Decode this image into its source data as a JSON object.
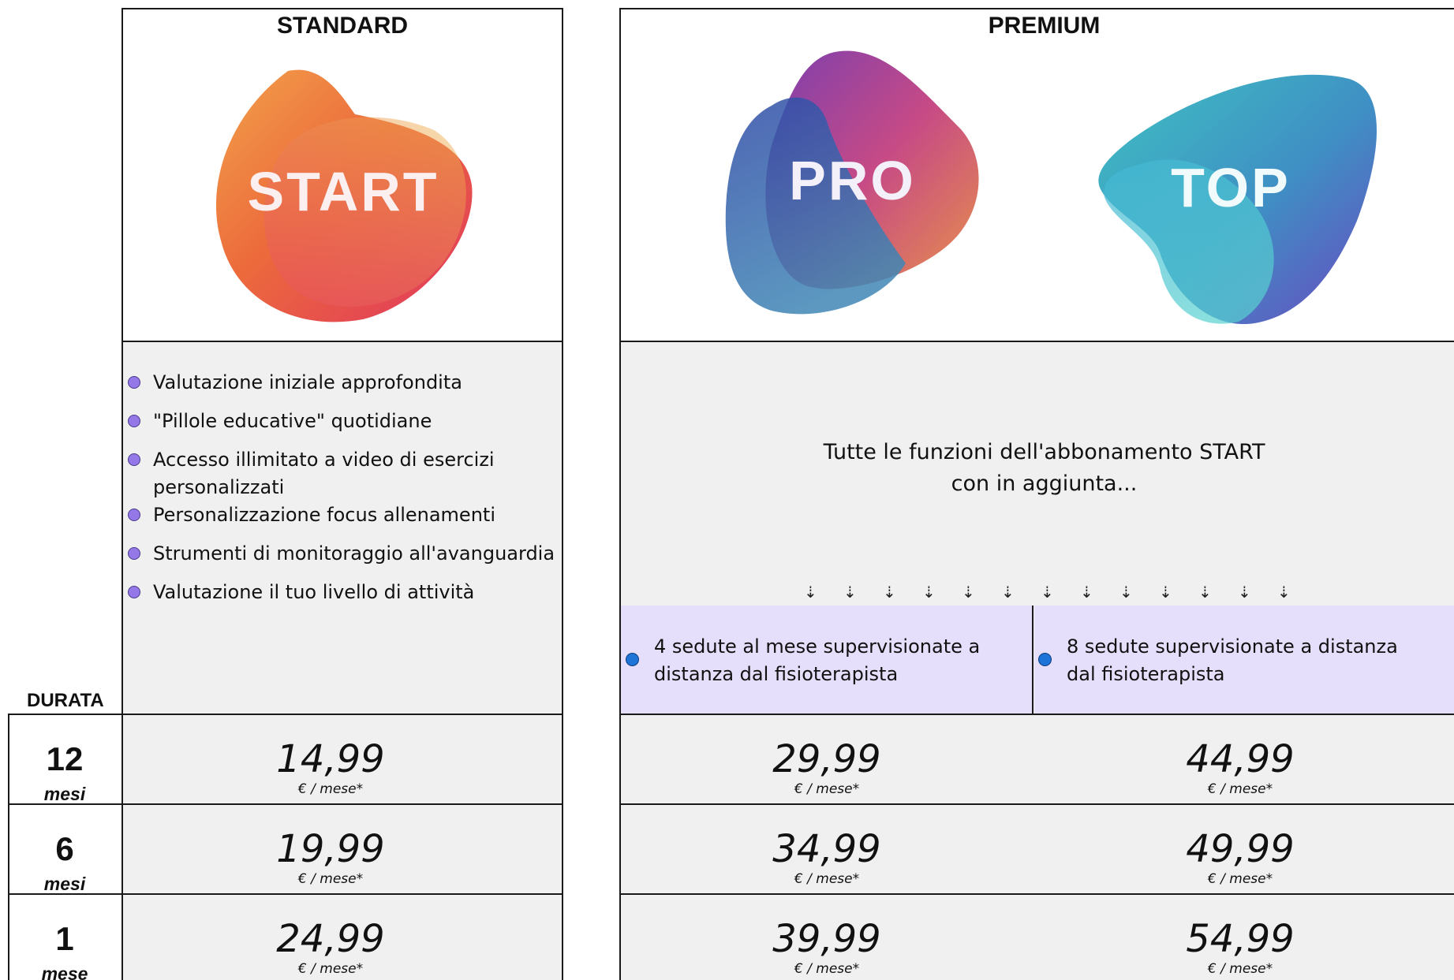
{
  "standard": {
    "title": "STANDARD",
    "logo": "START",
    "features": [
      "Valutazione iniziale approfondita",
      "\"Pillole educative\" quotidiane",
      "Accesso illimitato a video di esercizi personalizzati",
      "Personalizzazione focus allenamenti",
      "Strumenti di monitoraggio all'avanguardia",
      "Valutazione il tuo livello di attività"
    ]
  },
  "premium": {
    "title": "PREMIUM",
    "logo_pro": "PRO",
    "logo_top": "TOP",
    "note_line1": "Tutte le funzioni dell'abbonamento START",
    "note_line2": "con in aggiunta...",
    "arrow_glyph": "⇣",
    "pro_extra": "4 sedute al mese supervisionate a distanza dal fisioterapista",
    "top_extra": "8 sedute supervisionate a distanza dal fisioterapista"
  },
  "duration_header": "DURATA",
  "price_unit": "€ / mese*",
  "rows": [
    {
      "num": "12",
      "unit": "mesi",
      "start": "14,99",
      "pro": "29,99",
      "top": "44,99"
    },
    {
      "num": "6",
      "unit": "mesi",
      "start": "19,99",
      "pro": "34,99",
      "top": "49,99"
    },
    {
      "num": "1",
      "unit": "mese",
      "start": "24,99",
      "pro": "39,99",
      "top": "54,99"
    }
  ],
  "colors": {
    "feature_bullet": "#9478e8",
    "extra_bullet": "#1f74d8",
    "grey_bg": "#f0f0f0",
    "lavender_bg": "#e6dffc"
  }
}
